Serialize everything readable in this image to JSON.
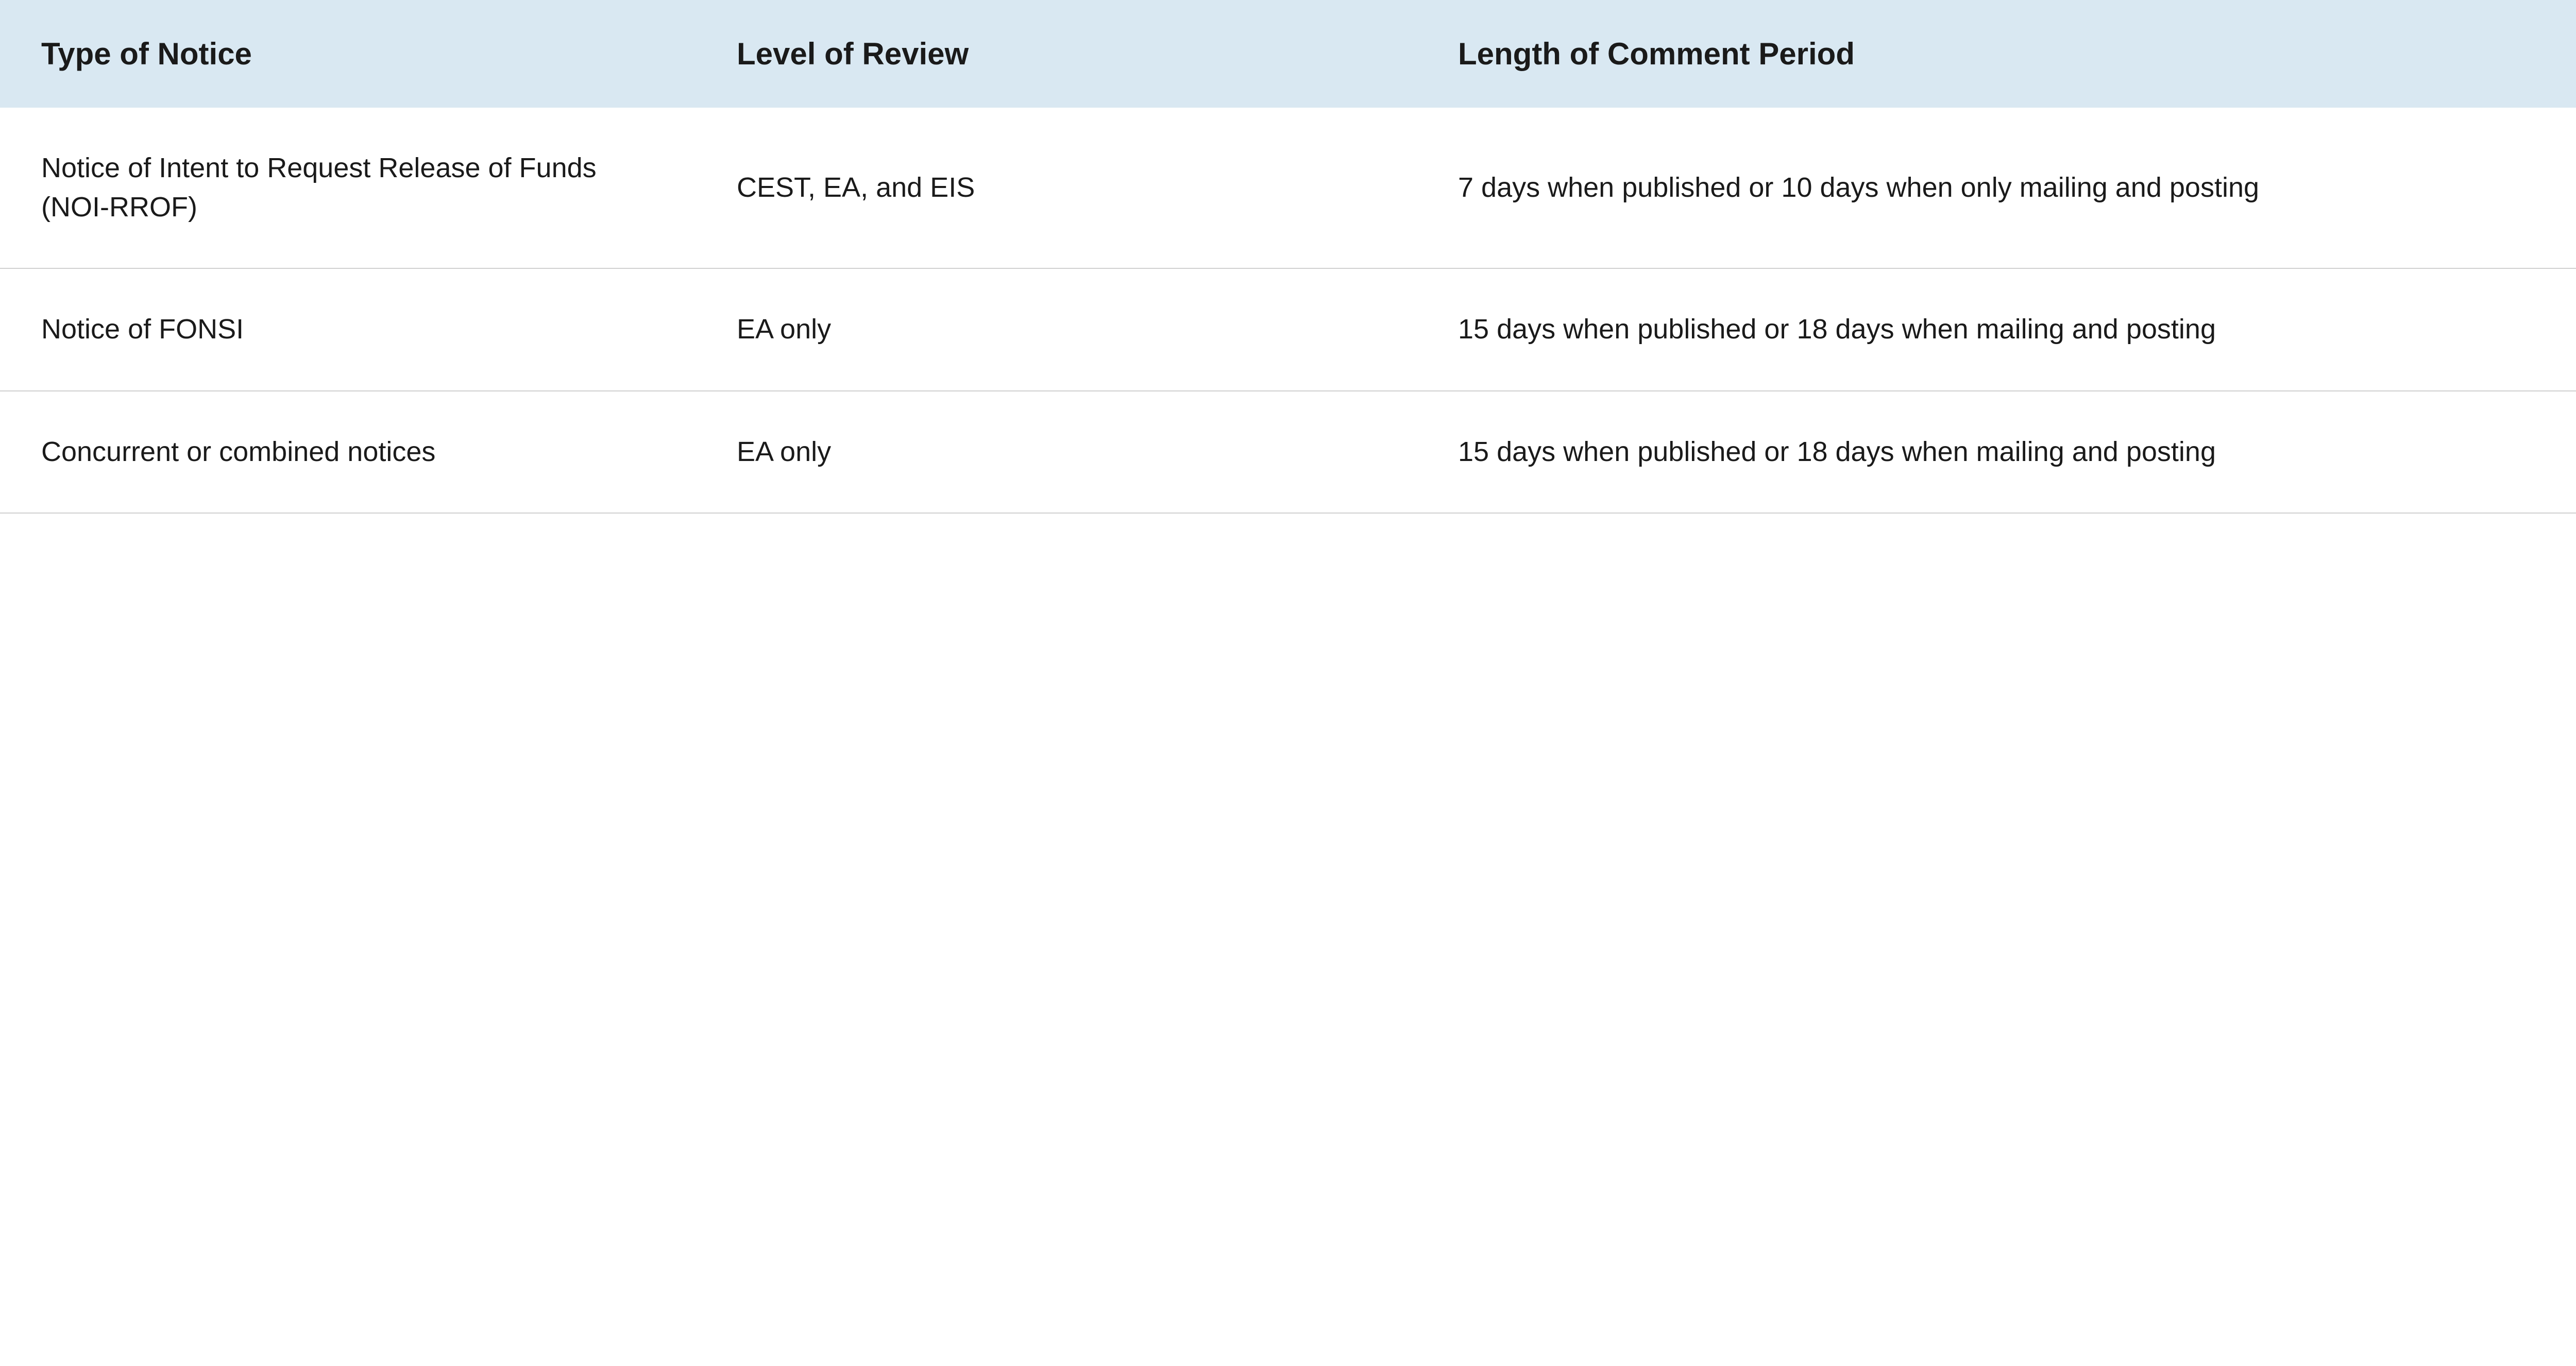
{
  "table": {
    "headers": {
      "col1": "Type of Notice",
      "col2": "Level of Review",
      "col3": "Length of Comment Period"
    },
    "rows": [
      {
        "type": "Notice of Intent to Request Release of Funds (NOI-RROF)",
        "level": "CEST, EA, and EIS",
        "length": "7 days when published or 10 days when only mailing and posting"
      },
      {
        "type": "Notice of FONSI",
        "level": "EA only",
        "length": "15 days when published or 18 days when mailing and posting"
      },
      {
        "type": "Concurrent or combined notices",
        "level": "EA only",
        "length": "15 days when published or 18 days when mailing and posting"
      }
    ]
  }
}
